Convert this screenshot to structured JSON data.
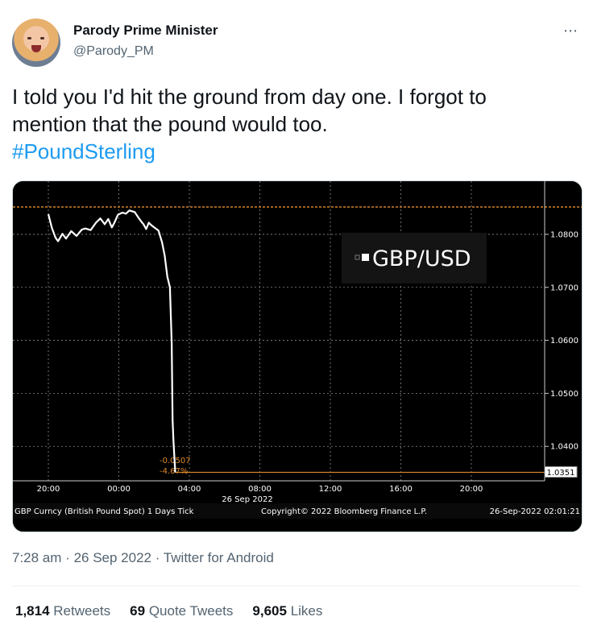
{
  "user": {
    "name": "Parody Prime Minister",
    "handle": "@Parody_PM",
    "more_icon": "⋯"
  },
  "tweet": {
    "text_line1": "I told you I'd hit the ground from day one. I forgot to",
    "text_line2": "mention that the pound would too.",
    "hashtag": "#PoundSterling"
  },
  "meta": {
    "time": "7:28 am",
    "sep1": "·",
    "date": "26 Sep 2022",
    "sep2": "·",
    "client": "Twitter for Android"
  },
  "stats": {
    "retweets_count": "1,814",
    "retweets_label": "Retweets",
    "quotes_count": "69",
    "quotes_label": "Quote Tweets",
    "likes_count": "9,605",
    "likes_label": "Likes"
  },
  "chart_data": {
    "type": "line",
    "title": "GBP/USD",
    "y_tick_labels": [
      "1.0800",
      "1.0700",
      "1.0600",
      "1.0500",
      "1.0400"
    ],
    "ylim": [
      1.0335,
      1.0885
    ],
    "x_tick_labels": [
      "20:00",
      "00:00",
      "04:00",
      "08:00",
      "12:00",
      "16:00",
      "20:00"
    ],
    "x_date_label": "26 Sep 2022",
    "last_price": "1.0351",
    "change_abs": "-0.0507",
    "change_pct": "-4.67%",
    "footer_left": "GBP Curncy (British Pound Spot) 1 Days  Tick",
    "footer_center": "Copyright© 2022 Bloomberg Finance L.P.",
    "footer_right": "26-Sep-2022 02:01:21",
    "series": [
      {
        "values": [
          [
            0,
            1.0838
          ],
          [
            0.2,
            1.0812
          ],
          [
            0.4,
            1.0794
          ],
          [
            0.55,
            1.0787
          ],
          [
            0.8,
            1.0801
          ],
          [
            1.0,
            1.0792
          ],
          [
            1.3,
            1.0806
          ],
          [
            1.6,
            1.0797
          ],
          [
            1.9,
            1.0809
          ],
          [
            2.1,
            1.0811
          ],
          [
            2.4,
            1.0808
          ],
          [
            2.7,
            1.0822
          ],
          [
            2.95,
            1.083
          ],
          [
            3.2,
            1.0819
          ],
          [
            3.4,
            1.0829
          ],
          [
            3.6,
            1.0813
          ],
          [
            3.75,
            1.0822
          ],
          [
            3.95,
            1.0837
          ],
          [
            4.2,
            1.0841
          ],
          [
            4.4,
            1.0839
          ],
          [
            4.6,
            1.0845
          ],
          [
            4.9,
            1.0842
          ],
          [
            5.1,
            1.0832
          ],
          [
            5.3,
            1.0823
          ],
          [
            5.4,
            1.0819
          ],
          [
            5.55,
            1.081
          ],
          [
            5.7,
            1.0822
          ],
          [
            5.85,
            1.0817
          ],
          [
            6.05,
            1.0812
          ],
          [
            6.25,
            1.0807
          ],
          [
            6.45,
            1.0785
          ],
          [
            6.6,
            1.076
          ],
          [
            6.75,
            1.072
          ],
          [
            6.9,
            1.07
          ],
          [
            7.0,
            1.0595
          ],
          [
            7.05,
            1.045
          ],
          [
            7.1,
            1.041
          ],
          [
            7.2,
            1.0351
          ]
        ]
      }
    ]
  }
}
